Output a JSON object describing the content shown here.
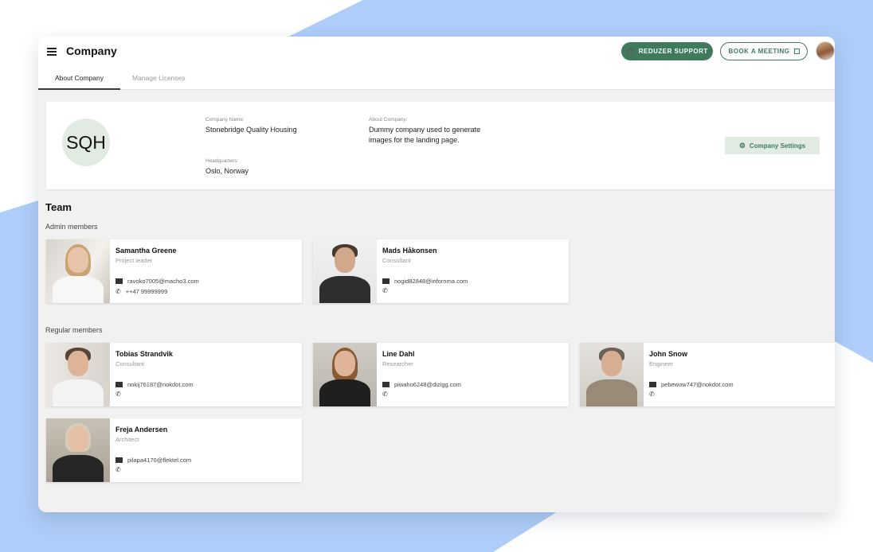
{
  "header": {
    "title": "Company",
    "support_label": "REDUZER SUPPORT",
    "meeting_label": "BOOK A MEETING"
  },
  "tabs": [
    {
      "label": "About Company",
      "active": true
    },
    {
      "label": "Manage Licenses",
      "active": false
    }
  ],
  "company": {
    "logo_text": "SQH",
    "name_label": "Company Name:",
    "name": "Stonebridge Quality Housing",
    "hq_label": "Headquarters:",
    "hq": "Oslo, Norway",
    "about_label": "About Company:",
    "about_line1": "Dummy company used to generate",
    "about_line2": "images for the landing page.",
    "settings_label": "Company Settings"
  },
  "team": {
    "heading": "Team",
    "admin_label": "Admin members",
    "regular_label": "Regular members",
    "admins": [
      {
        "name": "Samantha Greene",
        "role": "Project leader",
        "email": "ravoko7005@macho3.com",
        "phone": "++47 99999999"
      },
      {
        "name": "Mads Håkonsen",
        "role": "Consultant",
        "email": "nogid82848@infornma.com",
        "phone": ""
      }
    ],
    "regulars": [
      {
        "name": "Tobias Strandvik",
        "role": "Consultant",
        "email": "nokij76187@nokdot.com",
        "phone": ""
      },
      {
        "name": "Line Dahl",
        "role": "Researcher",
        "email": "piwaho6248@dizigg.com",
        "phone": ""
      },
      {
        "name": "John Snow",
        "role": "Engineer",
        "email": "pebewow747@nokdot.com",
        "phone": ""
      },
      {
        "name": "Freja Andersen",
        "role": "Architect",
        "email": "pilapa4170@flektel.com",
        "phone": ""
      }
    ]
  },
  "colors": {
    "accent": "#3f7a5d",
    "accent_light": "#e1ebe1",
    "background_shape": "#aecdf8"
  }
}
